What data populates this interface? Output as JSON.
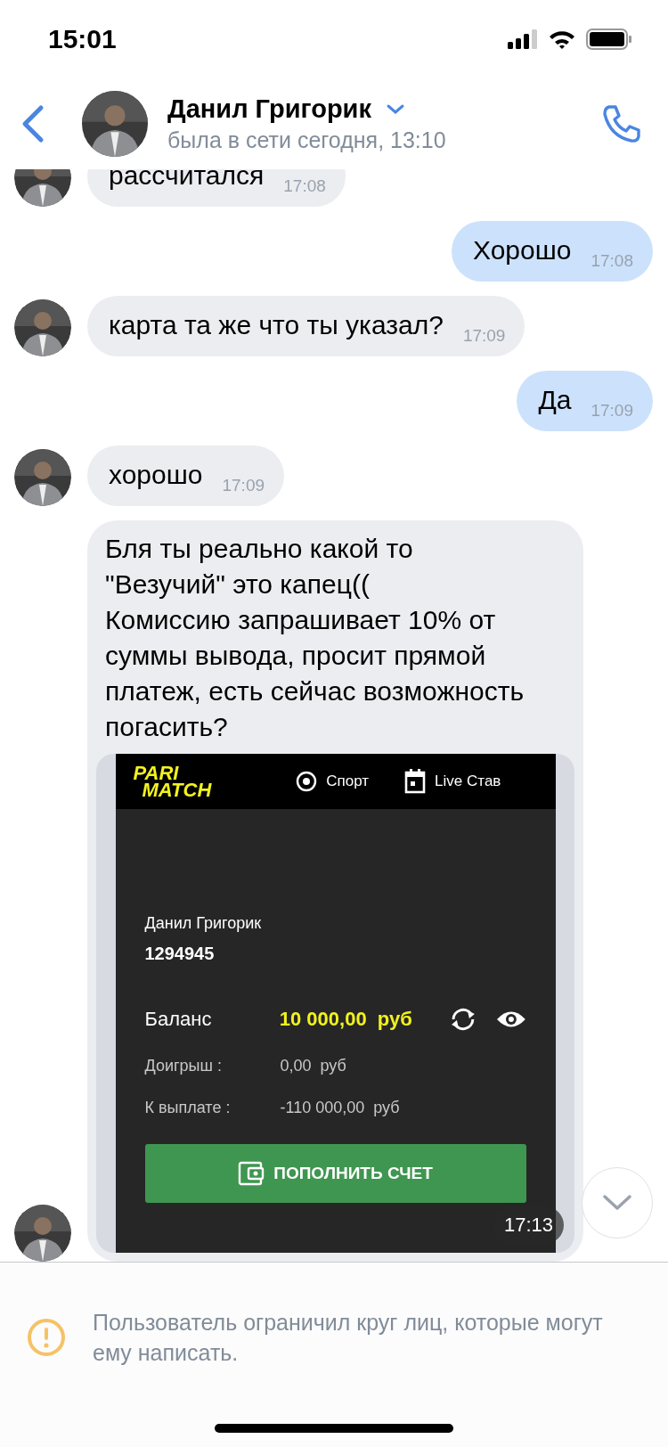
{
  "status_bar": {
    "time": "15:01"
  },
  "header": {
    "name": "Данил Григорик",
    "status": "была в сети сегодня, 13:10"
  },
  "messages": [
    {
      "kind": "incoming",
      "avatar": true,
      "text": "рассчитался",
      "time": "17:08"
    },
    {
      "kind": "outgoing",
      "avatar": false,
      "text": "Хорошо",
      "time": "17:08"
    },
    {
      "kind": "incoming",
      "avatar": true,
      "text": "карта та же что ты указал?",
      "time": "17:09"
    },
    {
      "kind": "outgoing",
      "avatar": false,
      "text": "Да",
      "time": "17:09"
    },
    {
      "kind": "incoming",
      "avatar": true,
      "text": "хорошо",
      "time": "17:09"
    },
    {
      "kind": "incoming",
      "avatar": true,
      "text": "Бля ты реально какой то \"Везучий\" это капец((\nКомиссию запрашивает 10% от суммы вывода, просит прямой платеж, есть сейчас возможность погасить?",
      "time": "17:13",
      "attachment": {
        "kind": "screenshot",
        "logo": [
          "PARI",
          "MATCH"
        ],
        "nav": [
          "Спорт",
          "Live Став"
        ],
        "account_name": "Данил Григорик",
        "account_id": "1294945",
        "balance_label": "Баланс",
        "balance_value": "10 000,00  руб",
        "rows": [
          {
            "label": "Доигрыш :",
            "value": "0,00  руб"
          },
          {
            "label": "К выплате :",
            "value": "-110 000,00  руб"
          }
        ],
        "button": "ПОПОЛНИТЬ СЧЕТ"
      }
    }
  ],
  "notice": {
    "text": "Пользователь ограничил круг лиц, которые могут ему написать."
  }
}
